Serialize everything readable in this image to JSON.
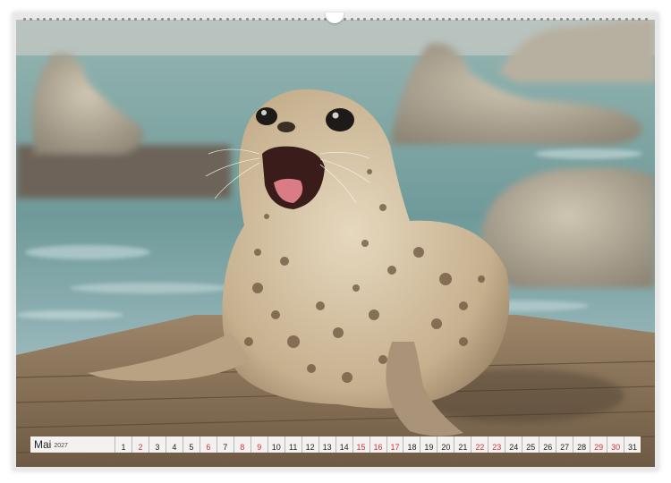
{
  "calendar": {
    "month": "Mai",
    "year": "2027",
    "days": [
      {
        "n": "1",
        "red": false
      },
      {
        "n": "2",
        "red": true
      },
      {
        "n": "3",
        "red": false
      },
      {
        "n": "4",
        "red": false
      },
      {
        "n": "5",
        "red": false
      },
      {
        "n": "6",
        "red": true
      },
      {
        "n": "7",
        "red": false
      },
      {
        "n": "8",
        "red": true
      },
      {
        "n": "9",
        "red": true
      },
      {
        "n": "10",
        "red": false
      },
      {
        "n": "11",
        "red": false
      },
      {
        "n": "12",
        "red": false
      },
      {
        "n": "13",
        "red": false
      },
      {
        "n": "14",
        "red": false
      },
      {
        "n": "15",
        "red": true
      },
      {
        "n": "16",
        "red": true
      },
      {
        "n": "17",
        "red": true
      },
      {
        "n": "18",
        "red": false
      },
      {
        "n": "19",
        "red": false
      },
      {
        "n": "20",
        "red": false
      },
      {
        "n": "21",
        "red": false
      },
      {
        "n": "22",
        "red": true
      },
      {
        "n": "23",
        "red": true
      },
      {
        "n": "24",
        "red": false
      },
      {
        "n": "25",
        "red": false
      },
      {
        "n": "26",
        "red": false
      },
      {
        "n": "27",
        "red": false
      },
      {
        "n": "28",
        "red": false
      },
      {
        "n": "29",
        "red": true
      },
      {
        "n": "30",
        "red": true
      },
      {
        "n": "31",
        "red": false
      }
    ]
  },
  "colors": {
    "holiday": "#d0303a",
    "text": "#222222",
    "water": "#7fa3a6",
    "dock": "#8a7358",
    "seal": "#c9b79a"
  }
}
